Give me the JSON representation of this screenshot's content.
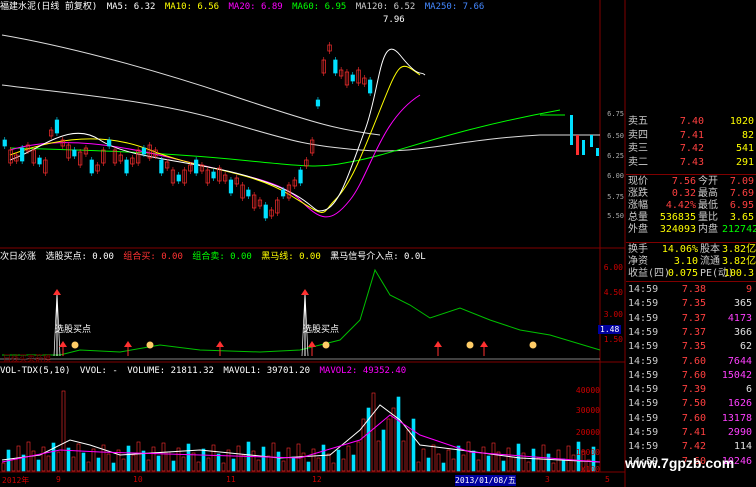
{
  "main_header": {
    "title": "福建水泥(日线 前复权)",
    "ma5": "MA5: 6.32",
    "ma10": "MA10: 6.56",
    "ma20": "MA20: 6.89",
    "ma60": "MA60: 6.95",
    "ma120": "MA120: 6.52",
    "ma250": "MA250: 7.66"
  },
  "main_high_label": "7.96",
  "main_low_label": "5.50",
  "price_ticks": [
    "6.75",
    "6.50",
    "6.25",
    "6.00",
    "5.75",
    "5.50"
  ],
  "ind_header": {
    "name": "次日必涨",
    "b1": "选股买点: 0.00",
    "b2": "组合买: 0.00",
    "b3": "组合卖: 0.00",
    "b4": "黑马线: 0.00",
    "b5": "黑马信号介入点: 0.0L"
  },
  "ind_label_1": "选股买点",
  "ind_label_2": "选股买点",
  "ind_ticks": [
    "6.00",
    "4.50",
    "3.00",
    "1.50"
  ],
  "ind_cursor_value": "1.48",
  "ind_footer": "日线买卖箭模",
  "vol_header": {
    "name": "VOL-TDX(5,10)",
    "vvol": "VVOL: -",
    "volume": "VOLUME: 21811.32",
    "mavol1": "MAVOL1: 39701.20",
    "mavol2": "MAVOL2: 49352.40"
  },
  "vol_ticks": [
    "40000",
    "30000",
    "20000",
    "10000"
  ],
  "vol_unit": "X100",
  "x_labels": [
    "2012年",
    "9",
    "10",
    "11",
    "12",
    "2013/01/08/五",
    "3",
    "5"
  ],
  "orderbook": [
    {
      "label": "卖五",
      "price": "7.40",
      "vol": "1020"
    },
    {
      "label": "卖四",
      "price": "7.41",
      "vol": "82"
    },
    {
      "label": "卖三",
      "price": "7.42",
      "vol": "541"
    },
    {
      "label": "卖二",
      "price": "7.43",
      "vol": "291"
    }
  ],
  "quote": [
    {
      "l1": "现价",
      "v1": "7.56",
      "l2": "今开",
      "v2": "7.09"
    },
    {
      "l1": "涨跌",
      "v1": "0.32",
      "l2": "最高",
      "v2": "7.69"
    },
    {
      "l1": "涨幅",
      "v1": "4.42%",
      "l2": "最低",
      "v2": "6.95"
    },
    {
      "l1": "总量",
      "v1": "536835",
      "l2": "量比",
      "v2": "3.65"
    },
    {
      "l1": "外盘",
      "v1": "324093",
      "l2": "内盘",
      "v2": "212742"
    }
  ],
  "stats": [
    {
      "l1": "换手",
      "v1": "14.06%",
      "l2": "股本",
      "v2": "3.82亿"
    },
    {
      "l1": "净资",
      "v1": "3.10",
      "l2": "流通",
      "v2": "3.82亿"
    },
    {
      "l1": "收益(四)",
      "v1": "0.075",
      "l2": "PE(动)",
      "v2": "100.3"
    }
  ],
  "ticks": [
    {
      "t": "14:59",
      "p": "7.38",
      "v": "9",
      "c": "#ff4040"
    },
    {
      "t": "14:59",
      "p": "7.35",
      "v": "365",
      "c": "#e0e0e0"
    },
    {
      "t": "14:59",
      "p": "7.37",
      "v": "4173",
      "c": "#ff40ff"
    },
    {
      "t": "14:59",
      "p": "7.37",
      "v": "366",
      "c": "#e0e0e0"
    },
    {
      "t": "14:59",
      "p": "7.35",
      "v": "62",
      "c": "#e0e0e0"
    },
    {
      "t": "14:59",
      "p": "7.60",
      "v": "7644",
      "c": "#ff40ff"
    },
    {
      "t": "14:59",
      "p": "7.60",
      "v": "15042",
      "c": "#ff40ff"
    },
    {
      "t": "14:59",
      "p": "7.39",
      "v": "6",
      "c": "#e0e0e0"
    },
    {
      "t": "14:59",
      "p": "7.50",
      "v": "1626",
      "c": "#ff40ff"
    },
    {
      "t": "14:59",
      "p": "7.60",
      "v": "13178",
      "c": "#ff40ff"
    },
    {
      "t": "14:59",
      "p": "7.41",
      "v": "2990",
      "c": "#ff40ff"
    },
    {
      "t": "14:59",
      "p": "7.42",
      "v": "114",
      "c": "#e0e0e0"
    },
    {
      "t": "14:59",
      "p": "7.60",
      "v": "10246",
      "c": "#ff40ff"
    }
  ],
  "watermark": "www.7gpzb.com",
  "colors": {
    "up": "#ff3030",
    "down": "#00e0ff",
    "ma5": "#ffffff",
    "ma10": "#ffff00",
    "ma20": "#ff00ff",
    "ma60": "#00ff00",
    "grid": "#800000"
  }
}
